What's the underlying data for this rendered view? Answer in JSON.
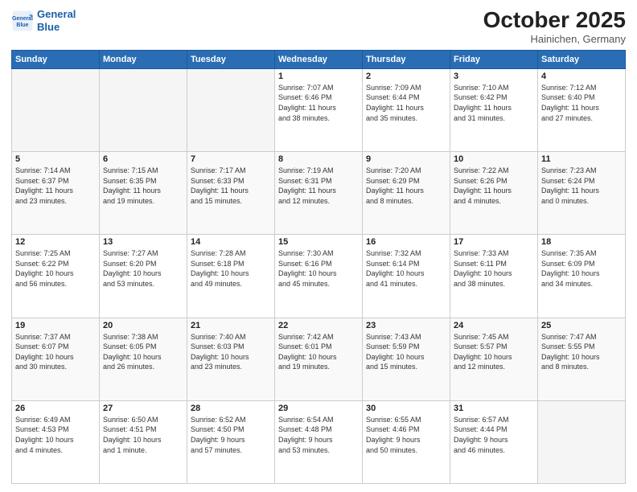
{
  "header": {
    "logo_line1": "General",
    "logo_line2": "Blue",
    "month": "October 2025",
    "location": "Hainichen, Germany"
  },
  "weekdays": [
    "Sunday",
    "Monday",
    "Tuesday",
    "Wednesday",
    "Thursday",
    "Friday",
    "Saturday"
  ],
  "weeks": [
    [
      {
        "day": "",
        "info": ""
      },
      {
        "day": "",
        "info": ""
      },
      {
        "day": "",
        "info": ""
      },
      {
        "day": "1",
        "info": "Sunrise: 7:07 AM\nSunset: 6:46 PM\nDaylight: 11 hours\nand 38 minutes."
      },
      {
        "day": "2",
        "info": "Sunrise: 7:09 AM\nSunset: 6:44 PM\nDaylight: 11 hours\nand 35 minutes."
      },
      {
        "day": "3",
        "info": "Sunrise: 7:10 AM\nSunset: 6:42 PM\nDaylight: 11 hours\nand 31 minutes."
      },
      {
        "day": "4",
        "info": "Sunrise: 7:12 AM\nSunset: 6:40 PM\nDaylight: 11 hours\nand 27 minutes."
      }
    ],
    [
      {
        "day": "5",
        "info": "Sunrise: 7:14 AM\nSunset: 6:37 PM\nDaylight: 11 hours\nand 23 minutes."
      },
      {
        "day": "6",
        "info": "Sunrise: 7:15 AM\nSunset: 6:35 PM\nDaylight: 11 hours\nand 19 minutes."
      },
      {
        "day": "7",
        "info": "Sunrise: 7:17 AM\nSunset: 6:33 PM\nDaylight: 11 hours\nand 15 minutes."
      },
      {
        "day": "8",
        "info": "Sunrise: 7:19 AM\nSunset: 6:31 PM\nDaylight: 11 hours\nand 12 minutes."
      },
      {
        "day": "9",
        "info": "Sunrise: 7:20 AM\nSunset: 6:29 PM\nDaylight: 11 hours\nand 8 minutes."
      },
      {
        "day": "10",
        "info": "Sunrise: 7:22 AM\nSunset: 6:26 PM\nDaylight: 11 hours\nand 4 minutes."
      },
      {
        "day": "11",
        "info": "Sunrise: 7:23 AM\nSunset: 6:24 PM\nDaylight: 11 hours\nand 0 minutes."
      }
    ],
    [
      {
        "day": "12",
        "info": "Sunrise: 7:25 AM\nSunset: 6:22 PM\nDaylight: 10 hours\nand 56 minutes."
      },
      {
        "day": "13",
        "info": "Sunrise: 7:27 AM\nSunset: 6:20 PM\nDaylight: 10 hours\nand 53 minutes."
      },
      {
        "day": "14",
        "info": "Sunrise: 7:28 AM\nSunset: 6:18 PM\nDaylight: 10 hours\nand 49 minutes."
      },
      {
        "day": "15",
        "info": "Sunrise: 7:30 AM\nSunset: 6:16 PM\nDaylight: 10 hours\nand 45 minutes."
      },
      {
        "day": "16",
        "info": "Sunrise: 7:32 AM\nSunset: 6:14 PM\nDaylight: 10 hours\nand 41 minutes."
      },
      {
        "day": "17",
        "info": "Sunrise: 7:33 AM\nSunset: 6:11 PM\nDaylight: 10 hours\nand 38 minutes."
      },
      {
        "day": "18",
        "info": "Sunrise: 7:35 AM\nSunset: 6:09 PM\nDaylight: 10 hours\nand 34 minutes."
      }
    ],
    [
      {
        "day": "19",
        "info": "Sunrise: 7:37 AM\nSunset: 6:07 PM\nDaylight: 10 hours\nand 30 minutes."
      },
      {
        "day": "20",
        "info": "Sunrise: 7:38 AM\nSunset: 6:05 PM\nDaylight: 10 hours\nand 26 minutes."
      },
      {
        "day": "21",
        "info": "Sunrise: 7:40 AM\nSunset: 6:03 PM\nDaylight: 10 hours\nand 23 minutes."
      },
      {
        "day": "22",
        "info": "Sunrise: 7:42 AM\nSunset: 6:01 PM\nDaylight: 10 hours\nand 19 minutes."
      },
      {
        "day": "23",
        "info": "Sunrise: 7:43 AM\nSunset: 5:59 PM\nDaylight: 10 hours\nand 15 minutes."
      },
      {
        "day": "24",
        "info": "Sunrise: 7:45 AM\nSunset: 5:57 PM\nDaylight: 10 hours\nand 12 minutes."
      },
      {
        "day": "25",
        "info": "Sunrise: 7:47 AM\nSunset: 5:55 PM\nDaylight: 10 hours\nand 8 minutes."
      }
    ],
    [
      {
        "day": "26",
        "info": "Sunrise: 6:49 AM\nSunset: 4:53 PM\nDaylight: 10 hours\nand 4 minutes."
      },
      {
        "day": "27",
        "info": "Sunrise: 6:50 AM\nSunset: 4:51 PM\nDaylight: 10 hours\nand 1 minute."
      },
      {
        "day": "28",
        "info": "Sunrise: 6:52 AM\nSunset: 4:50 PM\nDaylight: 9 hours\nand 57 minutes."
      },
      {
        "day": "29",
        "info": "Sunrise: 6:54 AM\nSunset: 4:48 PM\nDaylight: 9 hours\nand 53 minutes."
      },
      {
        "day": "30",
        "info": "Sunrise: 6:55 AM\nSunset: 4:46 PM\nDaylight: 9 hours\nand 50 minutes."
      },
      {
        "day": "31",
        "info": "Sunrise: 6:57 AM\nSunset: 4:44 PM\nDaylight: 9 hours\nand 46 minutes."
      },
      {
        "day": "",
        "info": ""
      }
    ]
  ]
}
